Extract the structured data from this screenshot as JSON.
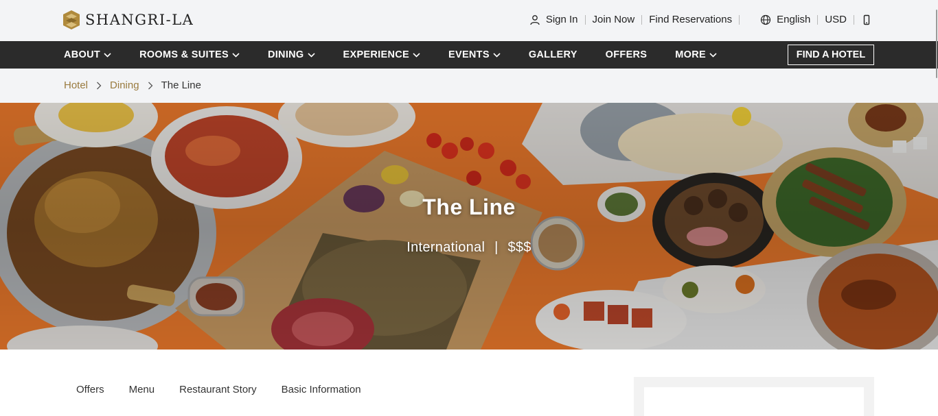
{
  "brand": {
    "name": "SHANGRI-LA",
    "logo_icon": "shangri-la-mark-icon",
    "gold": "#b08a3c"
  },
  "utility": {
    "sign_in": "Sign In",
    "join_now": "Join Now",
    "find_reservations": "Find Reservations",
    "language": "English",
    "currency": "USD",
    "icons": [
      "user-icon",
      "globe-icon",
      "mobile-phone-icon"
    ]
  },
  "nav": {
    "items": [
      {
        "label": "ABOUT",
        "has_dropdown": true
      },
      {
        "label": "ROOMS & SUITES",
        "has_dropdown": true
      },
      {
        "label": "DINING",
        "has_dropdown": true
      },
      {
        "label": "EXPERIENCE",
        "has_dropdown": true
      },
      {
        "label": "EVENTS",
        "has_dropdown": true
      },
      {
        "label": "GALLERY",
        "has_dropdown": false
      },
      {
        "label": "OFFERS",
        "has_dropdown": false
      },
      {
        "label": "MORE",
        "has_dropdown": true
      }
    ],
    "find_hotel": "FIND A HOTEL",
    "bar_color": "#2b2b2b"
  },
  "breadcrumb": {
    "items": [
      "Hotel",
      "Dining"
    ],
    "current": "The Line",
    "link_color": "#9a7b3f"
  },
  "hero": {
    "title": "The Line",
    "cuisine": "International",
    "separator": "|",
    "price": "$$$",
    "accent_color": "#f07a2a"
  },
  "tabs": [
    "Offers",
    "Menu",
    "Restaurant Story",
    "Basic Information"
  ]
}
